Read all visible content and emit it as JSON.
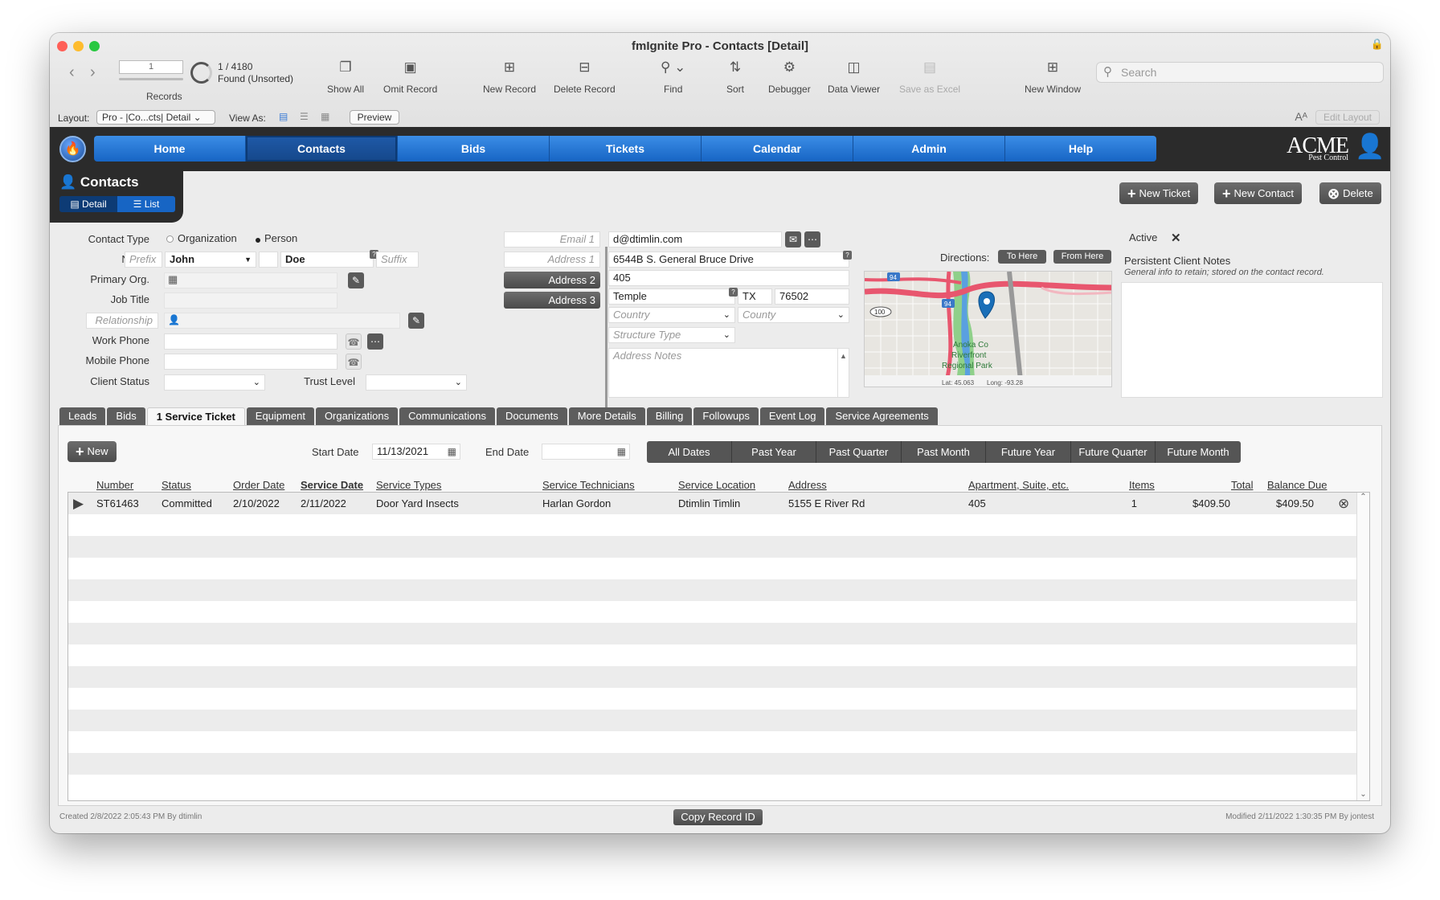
{
  "window": {
    "title": "fmIgnite Pro - Contacts [Detail]"
  },
  "toolbar": {
    "record_field": "1",
    "record_count": "1 / 4180",
    "found_status": "Found (Unsorted)",
    "records_label": "Records",
    "show_all": "Show All",
    "omit_record": "Omit Record",
    "new_record": "New Record",
    "delete_record": "Delete Record",
    "find": "Find",
    "sort": "Sort",
    "debugger": "Debugger",
    "data_viewer": "Data Viewer",
    "save_as_excel": "Save as Excel",
    "new_window": "New Window",
    "search_placeholder": "Search"
  },
  "layoutbar": {
    "layout_label": "Layout:",
    "layout_value": "Pro - |Co...cts| Detail",
    "view_as_label": "View As:",
    "preview": "Preview",
    "edit_layout": "Edit Layout",
    "aa": "Aᴬ"
  },
  "nav": {
    "items": [
      "Home",
      "Contacts",
      "Bids",
      "Tickets",
      "Calendar",
      "Admin",
      "Help"
    ],
    "active": "Contacts"
  },
  "brand": {
    "name": "ACME",
    "sub": "Pest Control"
  },
  "module": {
    "title": "Contacts",
    "detail": "Detail",
    "list": "List"
  },
  "actions": {
    "new_ticket": "New Ticket",
    "new_contact": "New Contact",
    "delete": "Delete"
  },
  "contact": {
    "contact_type_label": "Contact Type",
    "type_org": "Organization",
    "type_person": "Person",
    "name_label": "Name",
    "prefix_ph": "Prefix",
    "first_name": "John",
    "last_name": "Doe",
    "suffix_ph": "Suffix",
    "primary_org_label": "Primary Org.",
    "job_title_label": "Job Title",
    "relationship_label": "Relationship",
    "work_phone_label": "Work Phone",
    "mobile_phone_label": "Mobile Phone",
    "client_status_label": "Client Status",
    "trust_level_label": "Trust Level"
  },
  "address": {
    "email_label": "Email 1",
    "email": "d@dtimlin.com",
    "address1_label": "Address 1",
    "address2_btn": "Address 2",
    "address3_btn": "Address 3",
    "street": "6544B S. General Bruce Drive",
    "street2": "405",
    "city": "Temple",
    "state": "TX",
    "zip": "76502",
    "country_ph": "Country",
    "county_ph": "County",
    "structure_ph": "Structure Type",
    "notes_ph": "Address Notes"
  },
  "map": {
    "directions_label": "Directions:",
    "to_here": "To Here",
    "from_here": "From Here",
    "park_label_1": "Anoka Co",
    "park_label_2": "Riverfront",
    "park_label_3": "Regional Park",
    "lat": "Lat: 45.063",
    "long": "Long: -93.28",
    "route_94": "94",
    "route_100": "100"
  },
  "notes": {
    "active_label": "Active",
    "active_mark": "✕",
    "title": "Persistent Client Notes",
    "subtitle": "General info to retain; stored on the contact record."
  },
  "tabs": [
    "Leads",
    "Bids",
    "1 Service Ticket",
    "Equipment",
    "Organizations",
    "Communications",
    "Documents",
    "More Details",
    "Billing",
    "Followups",
    "Event Log",
    "Service Agreements"
  ],
  "tickets": {
    "new_btn": "New",
    "start_date_label": "Start Date",
    "start_date": "11/13/2021",
    "end_date_label": "End Date",
    "date_filters": [
      "All Dates",
      "Past Year",
      "Past Quarter",
      "Past Month",
      "Future Year",
      "Future Quarter",
      "Future Month"
    ],
    "columns": [
      "Number",
      "Status",
      "Order Date",
      "Service Date",
      "Service Types",
      "Service Technicians",
      "Service Location",
      "Address",
      "Apartment, Suite, etc.",
      "Items",
      "Total",
      "Balance Due"
    ],
    "rows": [
      [
        "ST61463",
        "Committed",
        "2/10/2022",
        "2/11/2022",
        "Door Yard Insects",
        "Harlan Gordon",
        "Dtimlin Timlin",
        "5155 E River Rd",
        "405",
        "1",
        "$409.50",
        "$409.50"
      ]
    ]
  },
  "footer": {
    "created": "Created 2/8/2022 2:05:43 PM By dtimlin",
    "copy_id": "Copy Record ID",
    "modified": "Modified 2/11/2022 1:30:35 PM By jontest"
  }
}
